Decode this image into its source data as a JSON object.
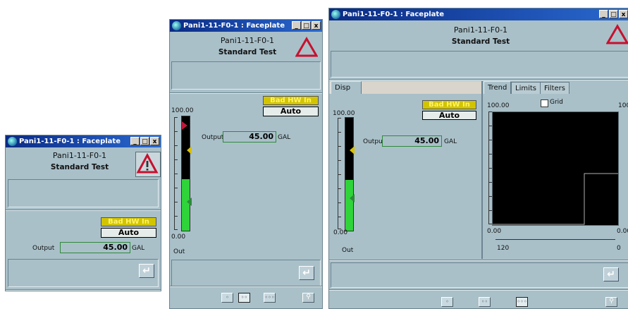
{
  "window_title": "Pani1-11-F0-1 : Faceplate",
  "tag_name": "Pani1-11-F0-1",
  "description": "Standard Test",
  "status": "Bad HW In",
  "mode": "Auto",
  "output": {
    "label": "Output",
    "value": "45.00",
    "unit": "GAL",
    "fraction": 0.45
  },
  "bar_scale": {
    "max_label": "100.00",
    "min_label": "0.00",
    "bar_label": "Out"
  },
  "enter_glyph": "↵",
  "view_buttons": [
    "◦",
    "◦◦",
    "◦◦◦"
  ],
  "pin_glyph": "⚲",
  "window_buttons": [
    "_",
    "□",
    "x"
  ],
  "tabs": {
    "disp": "Disp",
    "trend": "Trend",
    "limits": "Limits",
    "filters": "Filters"
  },
  "trend": {
    "grid_label": "Grid",
    "y_max": "100.00",
    "y_min": "0.00",
    "time_start": "120",
    "time_end": "0"
  },
  "colors": {
    "title_bar": "#0a2a84",
    "panel": "#a9c0c9",
    "bar_fill": "#2fd33a",
    "status_bg": "#d2c400",
    "alarm": "#c8102e"
  }
}
